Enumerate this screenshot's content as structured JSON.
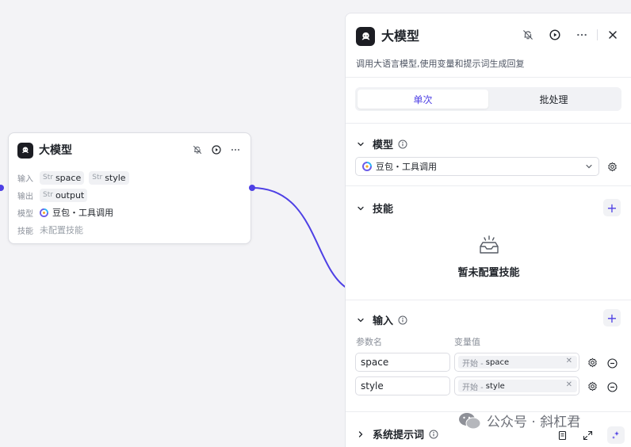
{
  "node": {
    "title": "大模型",
    "input_label": "输入",
    "output_label": "输出",
    "model_label": "模型",
    "skills_label": "技能",
    "inputs": [
      {
        "type": "Str",
        "name": "space"
      },
      {
        "type": "Str",
        "name": "style"
      }
    ],
    "outputs": [
      {
        "type": "Str",
        "name": "output"
      }
    ],
    "model_name": "豆包・工具调用",
    "skills_value": "未配置技能"
  },
  "panel": {
    "title": "大模型",
    "description": "调用大语言模型,使用变量和提示词生成回复",
    "tabs": [
      {
        "label": "单次",
        "active": true
      },
      {
        "label": "批处理",
        "active": false
      }
    ],
    "model_section": {
      "title": "模型",
      "selected": "豆包・工具调用"
    },
    "skills_section": {
      "title": "技能",
      "add_label": "+",
      "empty_text": "暂未配置技能"
    },
    "input_section": {
      "title": "输入",
      "add_label": "+",
      "param_header": "参数名",
      "value_header": "变量值",
      "rows": [
        {
          "name": "space",
          "source": "开始 -",
          "ref": "space"
        },
        {
          "name": "style",
          "source": "开始 -",
          "ref": "style"
        }
      ]
    },
    "system_prompt_section": {
      "title": "系统提示词"
    }
  },
  "watermark": {
    "text": "公众号 · 斜杠君"
  },
  "colors": {
    "accent": "#4e40e5",
    "edge": "#4e40e5",
    "canvas_bg": "#f3f3f6"
  }
}
